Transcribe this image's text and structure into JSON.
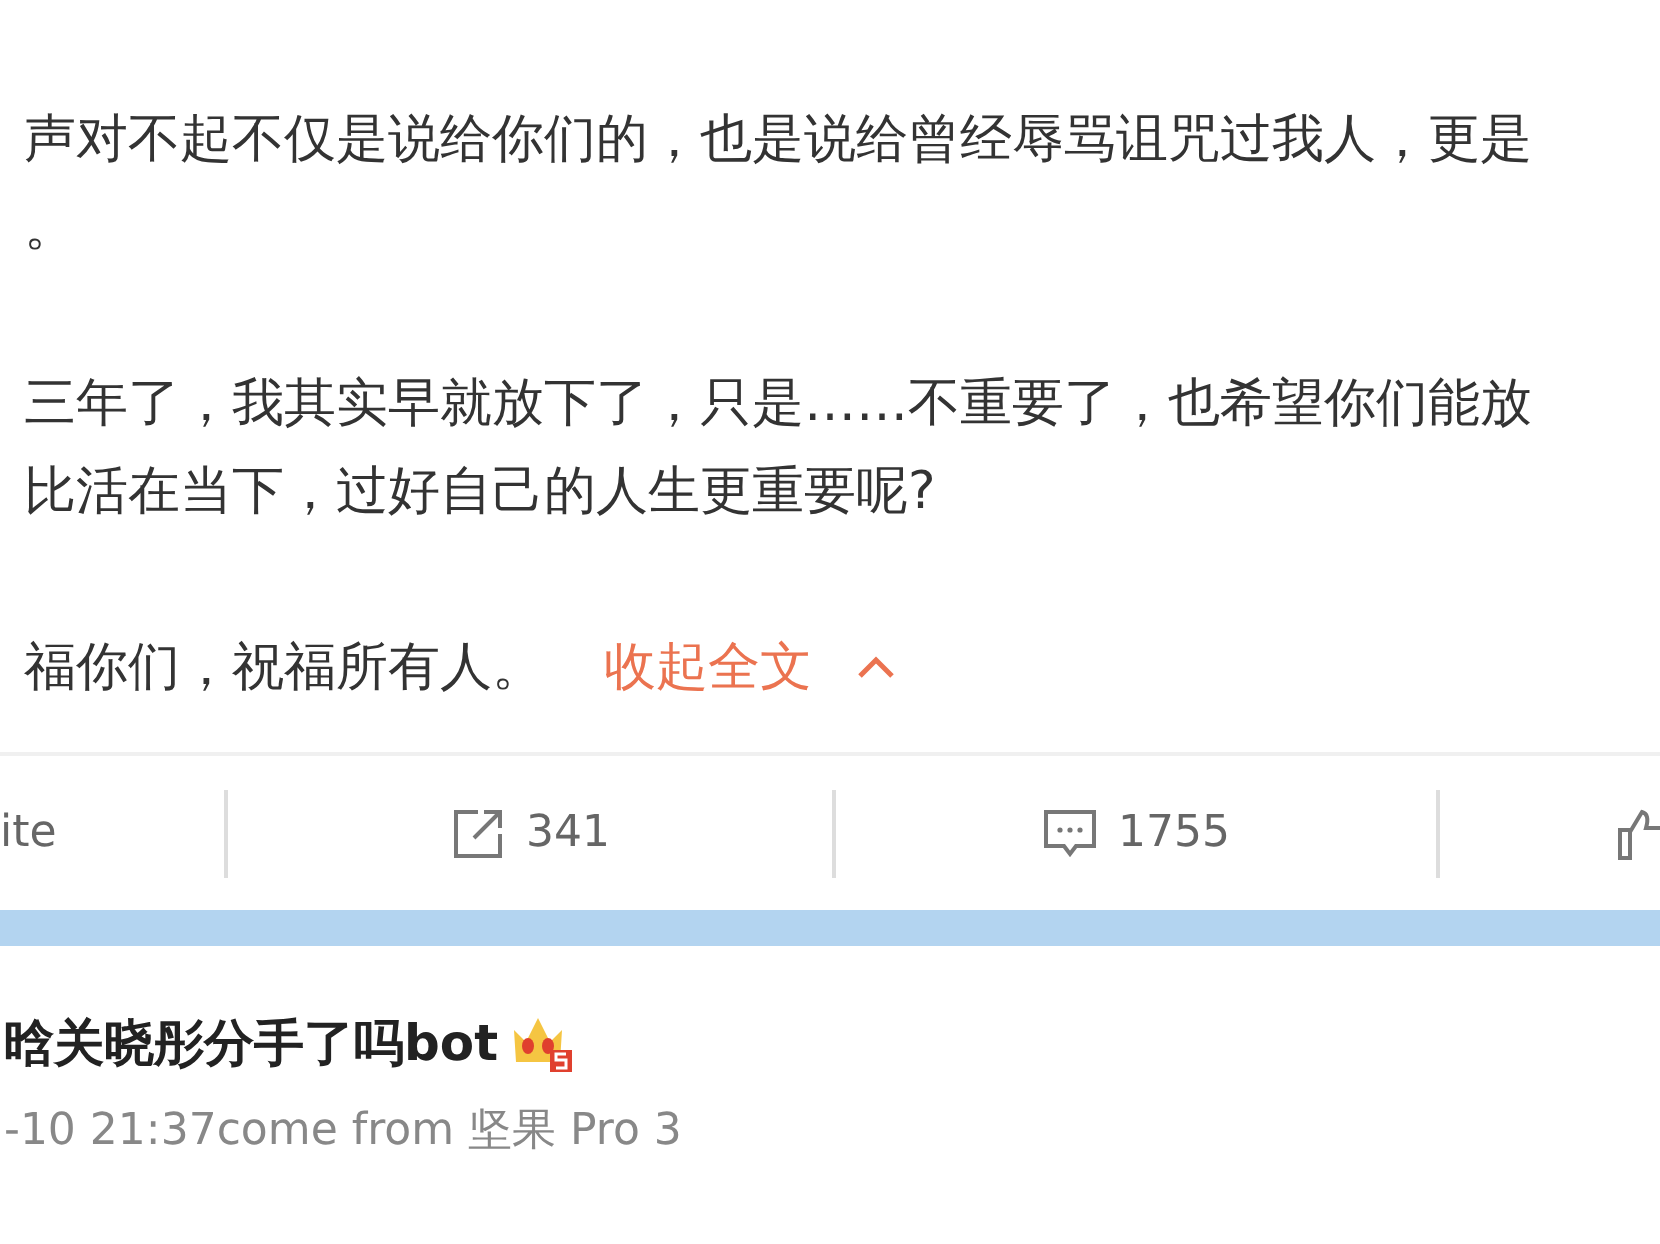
{
  "post": {
    "paragraphs": [
      {
        "lines": [
          "声对不起不仅是说给你们的，也是说给曾经辱骂诅咒过我人，更是",
          "。"
        ]
      },
      {
        "lines": [
          "三年了，我其实早就放下了，只是……不重要了，也希望你们能放",
          "比活在当下，过好自己的人生更重要呢?"
        ]
      },
      {
        "lines": [
          "福你们，祝福所有人。"
        ]
      }
    ],
    "collapse_link": "收起全文"
  },
  "actions": [
    {
      "kind": "text",
      "label": "ite"
    },
    {
      "kind": "repost",
      "label": "341"
    },
    {
      "kind": "comment",
      "label": "1755"
    },
    {
      "kind": "like"
    }
  ],
  "comment": {
    "username": "晗关晓彤分手了吗bot",
    "meta": "-10 21:37come from 坚果 Pro 3"
  }
}
